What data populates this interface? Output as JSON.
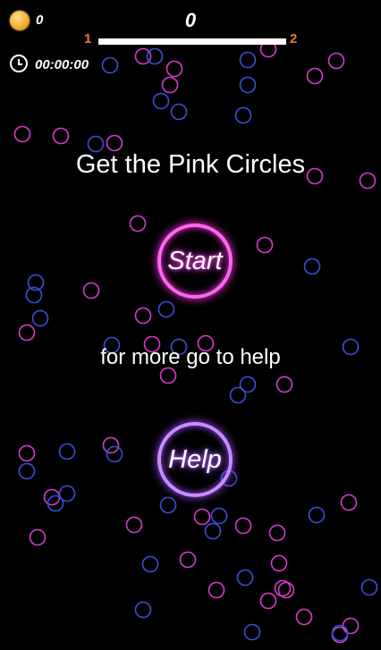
{
  "hud": {
    "coins": "0",
    "score": "0",
    "level_current": "1",
    "level_next": "2",
    "level_progress": 1.0,
    "timer": "00:00:00"
  },
  "menu": {
    "title": "Get the Pink Circles",
    "start_label": "Start",
    "hint": "for more go to help",
    "help_label": "Help"
  },
  "colors": {
    "background": "#000000",
    "pink": "#d83ad0",
    "blue": "#3b4fd8",
    "level_text": "#f07a2a"
  },
  "icons": {
    "coin": "coin-icon",
    "clock": "clock-icon"
  }
}
